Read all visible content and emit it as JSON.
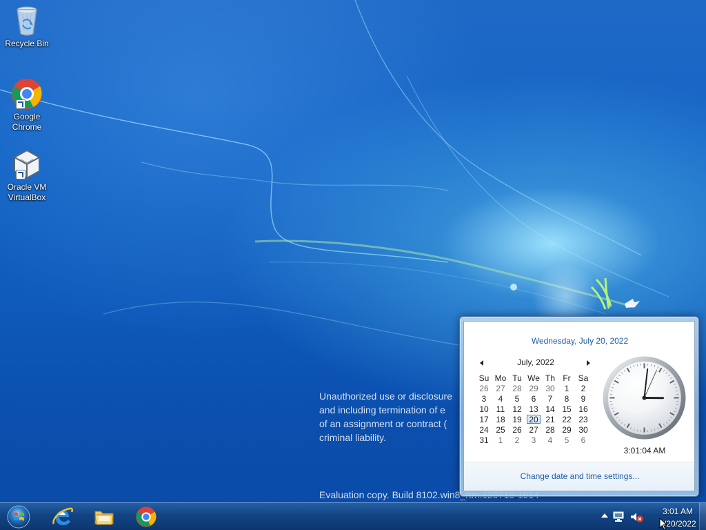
{
  "desktop": {
    "icons": [
      {
        "label": "Recycle Bin",
        "icon": "recycle-bin-icon",
        "shortcut": false
      },
      {
        "label": "Google\nChrome",
        "icon": "chrome-icon",
        "shortcut": true
      },
      {
        "label": "Oracle VM\nVirtualBox",
        "icon": "virtualbox-icon",
        "shortcut": true
      }
    ],
    "watermark": [
      "Unauthorized use or disclosure",
      "and including termination of e",
      "of an assignment or contract (",
      "criminal liability."
    ],
    "build_text": "Evaluation copy. Build 8102.win8_rtm.120715-1914"
  },
  "calendar": {
    "long_date": "Wednesday, July 20, 2022",
    "month_title": "July, 2022",
    "weekdays": [
      "Su",
      "Mo",
      "Tu",
      "We",
      "Th",
      "Fr",
      "Sa"
    ],
    "weeks": [
      [
        "26",
        "27",
        "28",
        "29",
        "30",
        "1",
        "2"
      ],
      [
        "3",
        "4",
        "5",
        "6",
        "7",
        "8",
        "9"
      ],
      [
        "10",
        "11",
        "12",
        "13",
        "14",
        "15",
        "16"
      ],
      [
        "17",
        "18",
        "19",
        "20",
        "21",
        "22",
        "23"
      ],
      [
        "24",
        "25",
        "26",
        "27",
        "28",
        "29",
        "30"
      ],
      [
        "31",
        "1",
        "2",
        "3",
        "4",
        "5",
        "6"
      ]
    ],
    "other_month_cells": [
      [
        0,
        0
      ],
      [
        0,
        1
      ],
      [
        0,
        2
      ],
      [
        0,
        3
      ],
      [
        0,
        4
      ],
      [
        5,
        1
      ],
      [
        5,
        2
      ],
      [
        5,
        3
      ],
      [
        5,
        4
      ],
      [
        5,
        5
      ],
      [
        5,
        6
      ]
    ],
    "today_cell": [
      3,
      3
    ],
    "analog_time": {
      "hour": 3,
      "minute": 1,
      "second": 4
    },
    "digital_time": "3:01:04 AM",
    "change_link": "Change date and time settings..."
  },
  "taskbar": {
    "apps": [
      {
        "name": "internet-explorer",
        "icon": "ie-icon"
      },
      {
        "name": "file-explorer",
        "icon": "folder-icon"
      },
      {
        "name": "google-chrome",
        "icon": "chrome-icon"
      }
    ],
    "tray": {
      "time": "3:01 AM",
      "date": "7/20/2022"
    }
  },
  "colors": {
    "desktop_blue": "#1464c6",
    "taskbar_blue": "#134381",
    "link_blue": "#1e5ca8"
  }
}
